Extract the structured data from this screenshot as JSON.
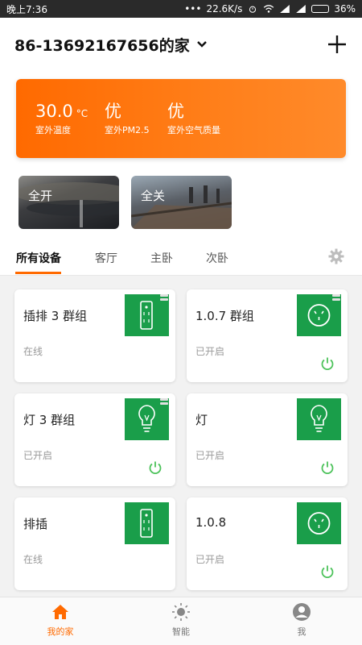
{
  "status_bar": {
    "time": "晚上7:36",
    "network_speed": "22.6K/s",
    "battery": "36%",
    "battery_level": 0.36
  },
  "header": {
    "home_name": "86-13692167656的家"
  },
  "weather": {
    "temperature": {
      "value": "30.0",
      "unit": "°C",
      "label": "室外温度"
    },
    "pm25": {
      "value": "优",
      "label": "室外PM2.5"
    },
    "air_quality": {
      "value": "优",
      "label": "室外空气质量"
    }
  },
  "scenes": [
    {
      "label": "全开"
    },
    {
      "label": "全关"
    }
  ],
  "tabs": [
    {
      "label": "所有设备",
      "active": true
    },
    {
      "label": "客厅"
    },
    {
      "label": "主卧"
    },
    {
      "label": "次卧"
    }
  ],
  "devices": [
    {
      "name": "插排 3 群组",
      "status": "在线",
      "icon": "power-strip-icon",
      "power_button": false
    },
    {
      "name": "1.0.7 群组",
      "status": "已开启",
      "icon": "socket-icon",
      "power_button": true
    },
    {
      "name": "灯 3 群组",
      "status": "已开启",
      "icon": "bulb-icon",
      "power_button": true
    },
    {
      "name": "灯",
      "status": "已开启",
      "icon": "bulb-icon",
      "power_button": true
    },
    {
      "name": "排插",
      "status": "在线",
      "icon": "power-strip-icon",
      "power_button": false
    },
    {
      "name": "1.0.8",
      "status": "已开启",
      "icon": "socket-icon",
      "power_button": true
    }
  ],
  "bottom_nav": [
    {
      "label": "我的家",
      "icon": "home-icon",
      "active": true
    },
    {
      "label": "智能",
      "icon": "sun-icon"
    },
    {
      "label": "我",
      "icon": "user-icon"
    }
  ],
  "colors": {
    "accent": "#ff6a00",
    "device_green": "#1a9e4a",
    "power_green": "#4cc25a"
  }
}
